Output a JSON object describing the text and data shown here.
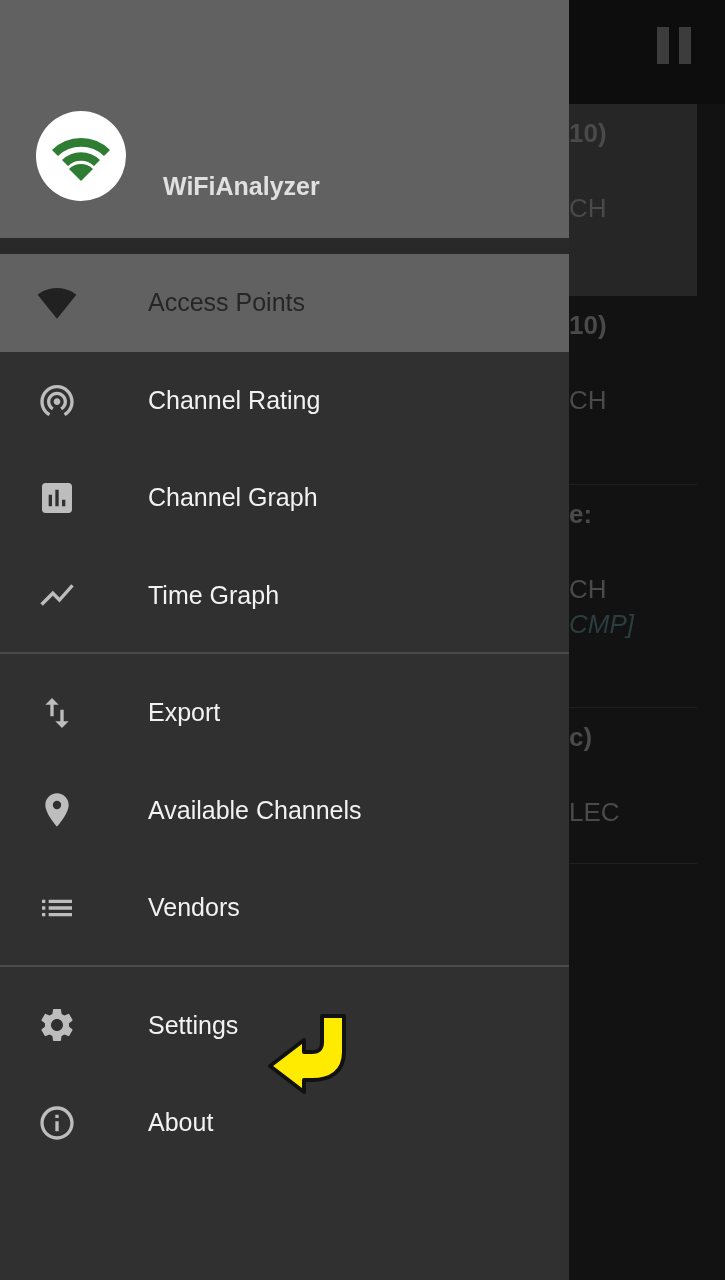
{
  "background": {
    "entries": [
      {
        "selected": true,
        "lines": [
          {
            "text": "10)",
            "kind": "heading"
          },
          {
            "text": "CH",
            "kind": "detail"
          }
        ]
      },
      {
        "selected": false,
        "lines": [
          {
            "text": "10)",
            "kind": "heading"
          },
          {
            "text": "CH",
            "kind": "detail"
          }
        ]
      },
      {
        "selected": false,
        "lines": [
          {
            "text": "e:",
            "kind": "heading"
          },
          {
            "text": "CH",
            "kind": "detail"
          },
          {
            "text": "CMP]",
            "kind": "note"
          }
        ]
      },
      {
        "selected": false,
        "lines": [
          {
            "text": "c)",
            "kind": "heading"
          },
          {
            "text": "LEC",
            "kind": "detail"
          }
        ]
      }
    ]
  },
  "drawer": {
    "header": {
      "title": "WiFiAnalyzer"
    },
    "sections": [
      {
        "items": [
          {
            "label": "Access Points",
            "selected": true
          },
          {
            "label": "Channel Rating",
            "selected": false
          },
          {
            "label": "Channel Graph",
            "selected": false
          },
          {
            "label": "Time Graph",
            "selected": false
          }
        ]
      },
      {
        "items": [
          {
            "label": "Export",
            "selected": false
          },
          {
            "label": "Available Channels",
            "selected": false
          },
          {
            "label": "Vendors",
            "selected": false
          }
        ]
      },
      {
        "items": [
          {
            "label": "Settings",
            "selected": false
          },
          {
            "label": "About",
            "selected": false
          }
        ]
      }
    ]
  }
}
